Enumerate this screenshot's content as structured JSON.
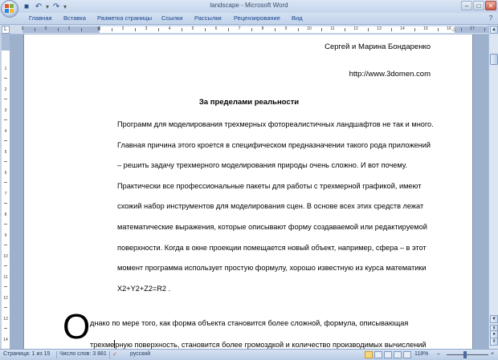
{
  "window": {
    "title": "landscape - Microsoft Word",
    "controls": {
      "minimize": "–",
      "maximize": "□",
      "close": "✕"
    }
  },
  "quick_access": [
    {
      "name": "save-icon",
      "glyph": "■"
    },
    {
      "name": "undo-icon",
      "glyph": "↶"
    },
    {
      "name": "redo-icon",
      "glyph": "↷"
    }
  ],
  "ribbon": {
    "tabs": [
      "Главная",
      "Вставка",
      "Разметка страницы",
      "Ссылки",
      "Рассылки",
      "Рецензирование",
      "Вид"
    ],
    "help_glyph": "?"
  },
  "ruler": {
    "corner_glyph": "L",
    "numbers": [
      "3",
      "2",
      "1",
      "1",
      "2",
      "3",
      "4",
      "5",
      "6",
      "7",
      "8",
      "9",
      "10",
      "11",
      "12",
      "13",
      "14",
      "15",
      "16",
      "17"
    ]
  },
  "vruler": {
    "numbers": [
      "1",
      "2",
      "3",
      "4",
      "5",
      "6",
      "7",
      "8",
      "9",
      "10",
      "11",
      "12",
      "13",
      "14"
    ]
  },
  "document": {
    "author": "Сергей и Марина  Бондаренко",
    "url": "http://www.3domen.com",
    "title": "За пределами реальности",
    "paragraph1": [
      "Программ для моделирования трехмерных фотореалистичных ландшафтов не так и много.",
      "Главная причина  этого кроется в специфическом  предназначении  такого рода приложений",
      "– решить задачу трехмерного  моделирования природы очень сложно. И вот почему.",
      "Практически все профессиональные  пакеты для работы с трехмерной графикой, имеют",
      "схожий набор инструментов для моделирования сцен.  В основе всех этих средств лежат",
      "математические выражения,  которые описывают форму создаваемой или редактируемой",
      "поверхности. Когда в окне проекции помещается новый объект, например, сфера – в этот",
      "момент программа использует простую формулу, хорошо известную  из курса математики",
      "X2+Y2+Z2=R2 ."
    ],
    "dropcap": "О",
    "paragraph2_line1": "днако по мере того, как форма объекта становится  более сложной, формула, описывающая",
    "paragraph2_line2_a": "трехме",
    "paragraph2_line2_b": "рную поверхность,  становится более громоздкой и количество производимых вычислений"
  },
  "statusbar": {
    "page": "Страница: 1 из 15",
    "words": "Число слов: 3 881",
    "language": "русский",
    "zoom": "118%",
    "zoom_minus": "–",
    "zoom_plus": "+"
  }
}
